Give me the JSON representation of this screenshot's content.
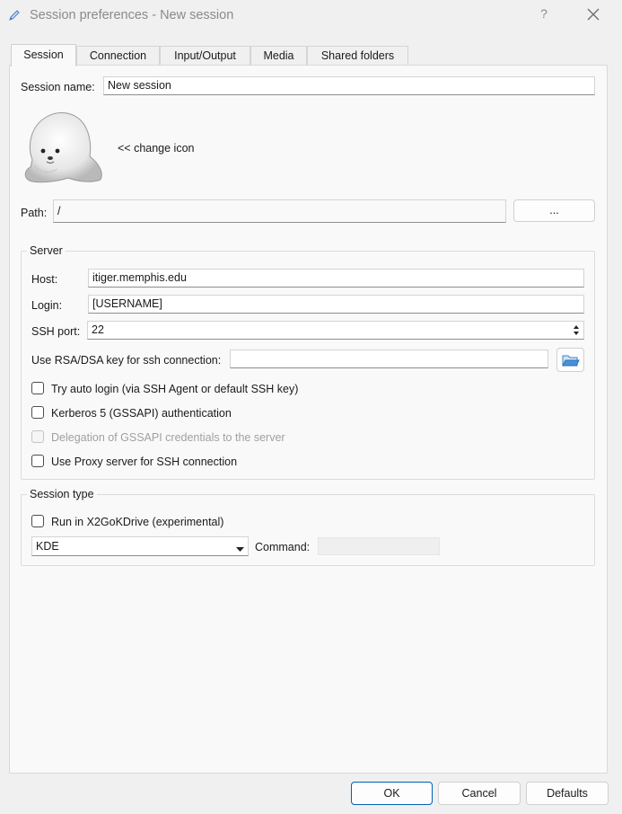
{
  "window": {
    "title": "Session preferences - New session",
    "help_glyph": "?",
    "icons": {
      "app": "pencil-icon",
      "close": "close-icon"
    }
  },
  "tabs": [
    {
      "label": "Session",
      "active": true
    },
    {
      "label": "Connection",
      "active": false
    },
    {
      "label": "Input/Output",
      "active": false
    },
    {
      "label": "Media",
      "active": false
    },
    {
      "label": "Shared folders",
      "active": false
    }
  ],
  "session": {
    "name_label": "Session name:",
    "name_value": "New session",
    "change_icon_label": "<< change icon",
    "path_label": "Path:",
    "path_value": "/",
    "path_browse_label": "..."
  },
  "server": {
    "title": "Server",
    "host_label": "Host:",
    "host_value": "itiger.memphis.edu",
    "login_label": "Login:",
    "login_value": "[USERNAME]",
    "ssh_port_label": "SSH port:",
    "ssh_port_value": "22",
    "rsa_label": "Use RSA/DSA key for ssh connection:",
    "rsa_value": "",
    "auto_login_label": "Try auto login (via SSH Agent or default SSH key)",
    "auto_login_checked": false,
    "kerberos_label": "Kerberos 5 (GSSAPI) authentication",
    "kerberos_checked": false,
    "delegation_label": "Delegation of GSSAPI credentials to the server",
    "delegation_checked": false,
    "proxy_label": "Use Proxy server for SSH connection",
    "proxy_checked": false
  },
  "session_type": {
    "title": "Session type",
    "x2go_label": "Run in X2GoKDrive (experimental)",
    "x2go_checked": false,
    "type_value": "KDE",
    "command_label": "Command:",
    "command_value": ""
  },
  "buttons": {
    "ok": "OK",
    "cancel": "Cancel",
    "defaults": "Defaults"
  },
  "colors": {
    "accent": "#005fb8",
    "folder_icon": "#4a90d9"
  }
}
